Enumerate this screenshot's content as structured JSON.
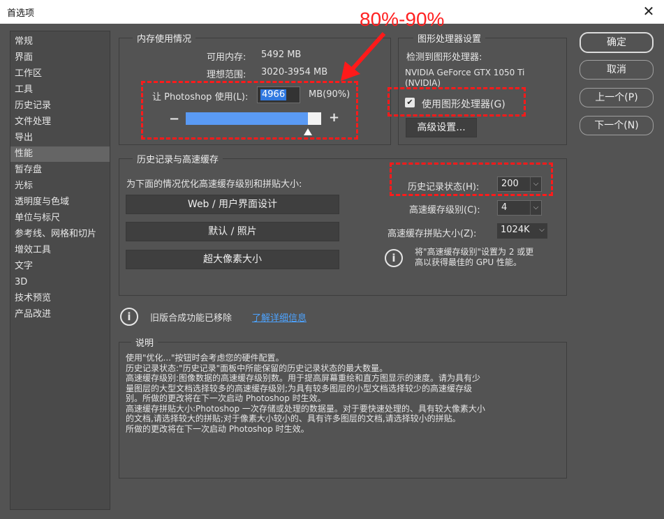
{
  "window": {
    "title": "首选项",
    "close_glyph": "✕"
  },
  "sidebar": {
    "items": [
      "常规",
      "界面",
      "工作区",
      "工具",
      "历史记录",
      "文件处理",
      "导出",
      "性能",
      "暂存盘",
      "光标",
      "透明度与色域",
      "单位与标尺",
      "参考线、网格和切片",
      "增效工具",
      "文字",
      "3D",
      "技术预览",
      "产品改进"
    ],
    "active_index": 7
  },
  "memory": {
    "group_title": "内存使用情况",
    "available_label": "可用内存:",
    "available_value": "5492 MB",
    "ideal_label": "理想范围:",
    "ideal_value": "3020-3954 MB",
    "let_label": "让 Photoshop 使用(L):",
    "input_value": "4966",
    "unit_percent": "MB(90%)",
    "minus": "−",
    "plus": "+",
    "slider_fraction": 0.9
  },
  "gpu": {
    "group_title": "图形处理器设置",
    "detected_label": "检测到图形处理器:",
    "gpu_name_line1": "NVIDIA GeForce GTX 1050 Ti",
    "gpu_name_line2": "(NVIDIA)",
    "use_gpu_label": "使用图形处理器(G)",
    "use_gpu_checked": true,
    "check_glyph": "✔",
    "advanced_button": "高级设置..."
  },
  "cache": {
    "group_title": "历史记录与高速缓存",
    "optimize_label": "为下面的情况优化高速缓存级别和拼贴大小:",
    "buttons": [
      "Web / 用户界面设计",
      "默认 / 照片",
      "超大像素大小"
    ],
    "history_states_label": "历史记录状态(H):",
    "history_states_value": "200",
    "cache_levels_label": "高速缓存级别(C):",
    "cache_levels_value": "4",
    "tile_size_label": "高速缓存拼贴大小(Z):",
    "tile_size_value": "1024K",
    "hint_line1": "将\"高速缓存级别\"设置为 2 或更",
    "hint_line2": "高以获得最佳的 GPU 性能。",
    "dropdown_glyph": "⌵"
  },
  "legacy": {
    "info_glyph": "i",
    "text": "旧版合成功能已移除",
    "link": "了解详细信息"
  },
  "description": {
    "group_title": "说明",
    "lines": [
      "使用\"优化...\"按钮时会考虑您的硬件配置。",
      "历史记录状态:\"历史记录\"面板中所能保留的历史记录状态的最大数量。",
      "高速缓存级别:图像数据的高速缓存级别数。用于提高屏幕重绘和直方图显示的速度。请为具有少",
      "量图层的大型文档选择较多的高速缓存级别;为具有较多图层的小型文档选择较少的高速缓存级",
      "别。所做的更改将在下一次启动 Photoshop 时生效。",
      "高速缓存拼贴大小:Photoshop 一次存储或处理的数据量。对于要快速处理的、具有较大像素大小",
      "的文档,请选择较大的拼贴;对于像素大小较小的、具有许多图层的文档,请选择较小的拼贴。",
      "所做的更改将在下一次启动 Photoshop 时生效。"
    ]
  },
  "buttons": {
    "ok": "确定",
    "cancel": "取消",
    "prev": "上一个(P)",
    "next": "下一个(N)"
  },
  "annotation": {
    "text": "80%-90%",
    "color": "#ff1a1a"
  }
}
